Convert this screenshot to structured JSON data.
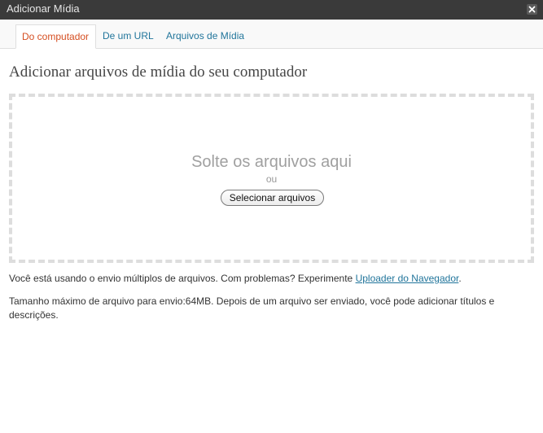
{
  "window": {
    "title": "Adicionar Mídia",
    "close_icon": "close-icon"
  },
  "tabs": [
    {
      "label": "Do computador",
      "active": true
    },
    {
      "label": "De um URL",
      "active": false
    },
    {
      "label": "Arquivos de Mídia",
      "active": false
    }
  ],
  "main": {
    "heading": "Adicionar arquivos de mídia do seu computador",
    "dropzone": {
      "drop_text": "Solte os arquivos aqui",
      "or_text": "ou",
      "select_button_label": "Selecionar arquivos"
    },
    "info": {
      "multi_upload_text": "Você está usando o envio múltiplos de arquivos. Com problemas? Experimente ",
      "browser_uploader_link": "Uploader do Navegador",
      "multi_upload_end": ".",
      "max_size_text": "Tamanho máximo de arquivo para envio:64MB. Depois de um arquivo ser enviado, você pode adicionar títulos e descrições."
    }
  },
  "colors": {
    "titlebar_bg": "#3a3a3a",
    "active_tab_text": "#d54e21",
    "link": "#21759b",
    "dropzone_border": "#dddddd"
  }
}
